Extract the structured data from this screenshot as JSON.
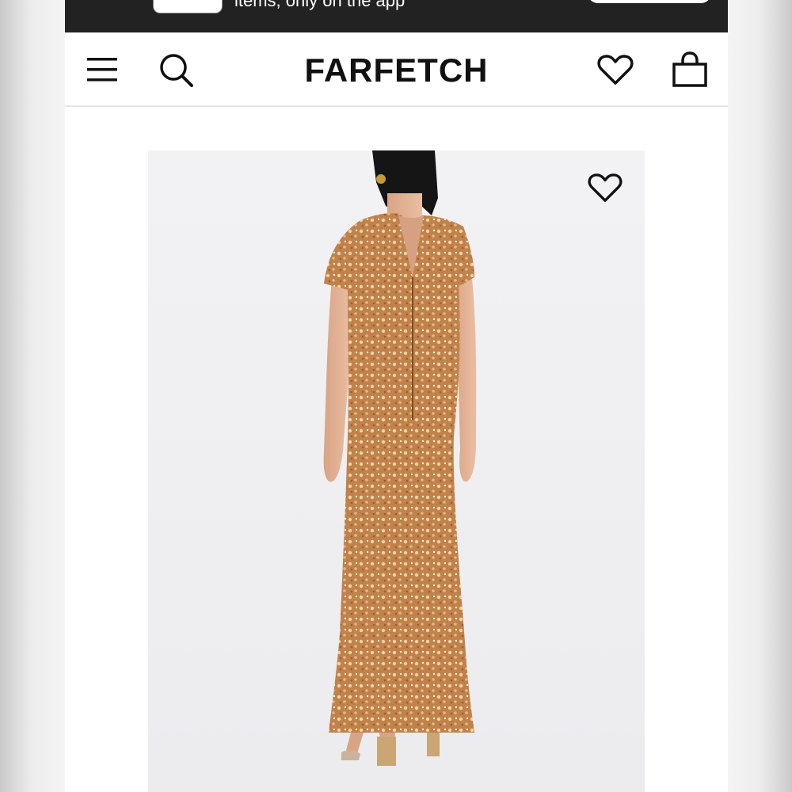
{
  "app_banner": {
    "text": "items, only on the app",
    "background": "#222222"
  },
  "header": {
    "brand": "FARFETCH",
    "icons": {
      "menu": "hamburger-menu-icon",
      "search": "search-icon",
      "wishlist": "heart-icon",
      "bag": "shopping-bag-icon"
    }
  },
  "product": {
    "image_description_icon": "sequin-maxi-dress-back-view",
    "wishlist_icon": "heart-icon",
    "colors": {
      "dress": "#c0824d",
      "sequin_highlight": "#f3d29a",
      "background": "#efeff2"
    }
  }
}
